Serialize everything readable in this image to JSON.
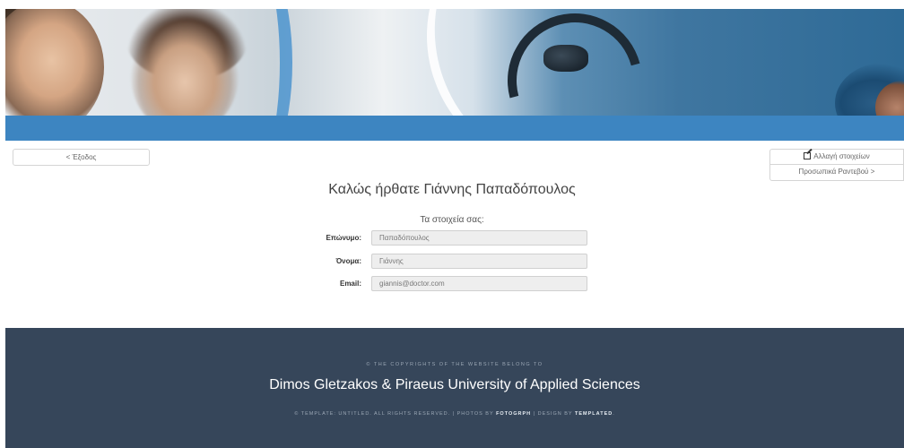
{
  "nav": {
    "exit_label": "< Έξοδος",
    "edit_label": "Αλλαγή στοιχείων",
    "appointments_label": "Προσωπικά Ραντεβού >"
  },
  "main": {
    "welcome": "Καλώς ήρθατε Γιάννης Παπαδόπουλος",
    "subtitle": "Τα στοιχεία σας:",
    "fields": [
      {
        "label": "Επώνυμο:",
        "value": "Παπαδόπουλος"
      },
      {
        "label": "Όνομα:",
        "value": "Γιάννης"
      },
      {
        "label": "Email:",
        "value": "giannis@doctor.com"
      }
    ]
  },
  "footer": {
    "copyright_note": "© The copyrights of the website belong to",
    "owners": "Dimos Gletzakos & Piraeus University of Applied Sciences",
    "template_text": "© Template: Untitled. All rights reserved. | Photos by ",
    "photos_by": "Fotogrph",
    "design_text": " | Design by ",
    "design_by": "Templated",
    "end_text": "."
  },
  "colors": {
    "accent_blue": "#3d85c1",
    "footer_bg": "#36465a"
  }
}
